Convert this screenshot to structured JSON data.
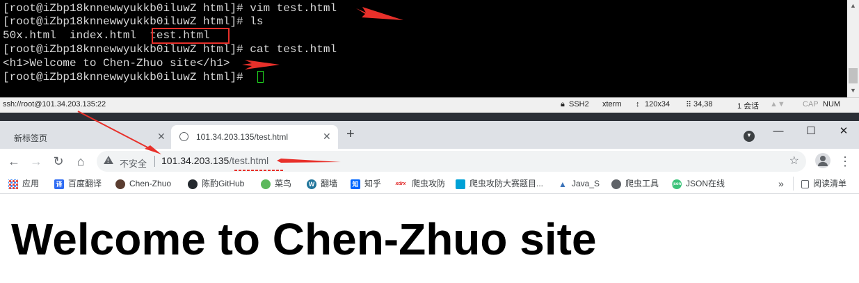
{
  "terminal": {
    "lines": [
      "[root@iZbp18knnewwyukkb0iluwZ html]# vim test.html",
      "[root@iZbp18knnewwyukkb0iluwZ html]# ls",
      "50x.html  index.html  test.html",
      "[root@iZbp18knnewwyukkb0iluwZ html]# cat test.html",
      "<h1>Welcome to Chen-Zhuo site</h1>",
      "[root@iZbp18knnewwyukkb0iluwZ html]# "
    ]
  },
  "statusbar": {
    "connection": "ssh://root@101.34.203.135:22",
    "protocol": "SSH2",
    "terminal_type": "xterm",
    "size": "120x34",
    "cursor_pos": "34,38",
    "sessions": "1 会话",
    "caps": "CAP",
    "num": "NUM"
  },
  "browser": {
    "tabs": [
      {
        "label": "新标签页",
        "active": false
      },
      {
        "label": "101.34.203.135/test.html",
        "active": true
      }
    ],
    "new_tab": "+",
    "omnibox": {
      "security": "不安全",
      "host": "101.34.203.135",
      "path": "/test.html"
    },
    "bookmarks": [
      {
        "label": "应用",
        "icon": "apps-grid-icon"
      },
      {
        "label": "百度翻译",
        "icon": "baidu-translate-icon",
        "color": "#2f6cf3"
      },
      {
        "label": "Chen-Zhuo",
        "icon": "avatar-icon",
        "color": "#5a3d30"
      },
      {
        "label": "陈酌GitHub",
        "icon": "github-icon",
        "color": "#24292e"
      },
      {
        "label": "菜鸟",
        "icon": "runoob-icon",
        "color": "#5cb85c"
      },
      {
        "label": "翻墙",
        "icon": "wordpress-icon",
        "color": "#21759b"
      },
      {
        "label": "知乎",
        "icon": "zhihu-icon",
        "color": "#0066ff"
      },
      {
        "label": "爬虫攻防",
        "icon": "xdrx-icon",
        "color": "#e02020"
      },
      {
        "label": "爬虫攻防大赛题目...",
        "icon": "bilibili-tv-icon",
        "color": "#00a1d6"
      },
      {
        "label": "Java_S",
        "icon": "mountain-icon",
        "color": "#3b73b9"
      },
      {
        "label": "爬虫工具",
        "icon": "globe-icon",
        "color": "#5f6368"
      },
      {
        "label": "JSON在线",
        "icon": "json-icon",
        "color": "#3cc37a"
      }
    ],
    "more": "»",
    "reading_list": "阅读清单"
  },
  "page": {
    "heading": "Welcome to Chen-Zhuo site"
  },
  "colors": {
    "annotation": "#e8302a",
    "terminal_bg": "#000000",
    "cursor": "#1fd51f"
  }
}
